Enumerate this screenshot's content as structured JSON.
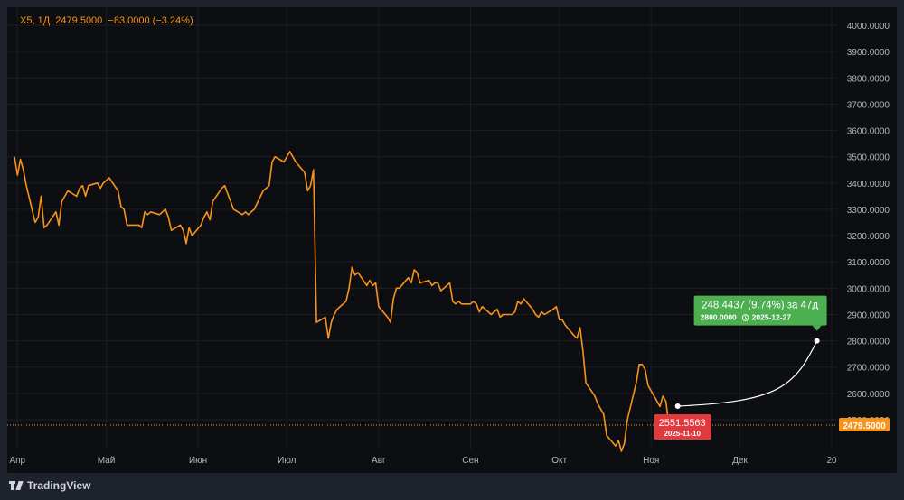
{
  "header": {
    "symbol": "X5",
    "interval": "1Д",
    "last_price": "2479.5000",
    "change": "−83.0000",
    "change_pct": "(−3.24%)"
  },
  "branding": {
    "name": "TradingView"
  },
  "colors": {
    "background": "#0d0e12",
    "line": "#f7931a",
    "grid": "#1b1d24",
    "axis_text": "#b2b5be",
    "price_label": "#f7931a",
    "measure_start": "#e03a3e",
    "measure_end": "#4caf50"
  },
  "measurement": {
    "start_price": "2551.5563",
    "start_date": "2025-11-10",
    "delta_text": "248.4437 (9.74%) за 47д",
    "end_price": "2800.0000",
    "end_date": "2025-12-27",
    "clock_icon": "clock-icon"
  },
  "chart_data": {
    "type": "line",
    "symbol": "X5",
    "interval": "1Д",
    "y_axis_ticks": [
      "4000.0000",
      "3900.0000",
      "3800.0000",
      "3700.0000",
      "3600.0000",
      "3500.0000",
      "3400.0000",
      "3300.0000",
      "3200.0000",
      "3100.0000",
      "3000.0000",
      "2900.0000",
      "2800.0000",
      "2700.0000",
      "2600.0000",
      "2500.0000"
    ],
    "x_axis_ticks": [
      "Апр",
      "Май",
      "Июн",
      "Июл",
      "Авг",
      "Сен",
      "Окт",
      "Ноя",
      "Дек",
      "20"
    ],
    "ylim": [
      2450,
      4040
    ],
    "xlim": [
      "2025-03-31",
      "2026-01-01"
    ],
    "last_price": 2479.5,
    "grid": true,
    "series": [
      {
        "values": [
          [
            "2025-03-31",
            3500
          ],
          [
            "2025-04-01",
            3430
          ],
          [
            "2025-04-02",
            3490
          ],
          [
            "2025-04-03",
            3450
          ],
          [
            "2025-04-04",
            3390
          ],
          [
            "2025-04-07",
            3250
          ],
          [
            "2025-04-08",
            3270
          ],
          [
            "2025-04-09",
            3350
          ],
          [
            "2025-04-10",
            3230
          ],
          [
            "2025-04-11",
            3240
          ],
          [
            "2025-04-14",
            3290
          ],
          [
            "2025-04-15",
            3240
          ],
          [
            "2025-04-16",
            3330
          ],
          [
            "2025-04-17",
            3350
          ],
          [
            "2025-04-18",
            3370
          ],
          [
            "2025-04-21",
            3350
          ],
          [
            "2025-04-22",
            3380
          ],
          [
            "2025-04-23",
            3390
          ],
          [
            "2025-04-24",
            3350
          ],
          [
            "2025-04-25",
            3390
          ],
          [
            "2025-04-28",
            3400
          ],
          [
            "2025-04-29",
            3380
          ],
          [
            "2025-04-30",
            3400
          ],
          [
            "2025-05-02",
            3420
          ],
          [
            "2025-05-05",
            3370
          ],
          [
            "2025-05-06",
            3310
          ],
          [
            "2025-05-07",
            3300
          ],
          [
            "2025-05-08",
            3240
          ],
          [
            "2025-05-12",
            3240
          ],
          [
            "2025-05-13",
            3230
          ],
          [
            "2025-05-14",
            3290
          ],
          [
            "2025-05-15",
            3280
          ],
          [
            "2025-05-16",
            3290
          ],
          [
            "2025-05-19",
            3280
          ],
          [
            "2025-05-20",
            3290
          ],
          [
            "2025-05-21",
            3300
          ],
          [
            "2025-05-22",
            3270
          ],
          [
            "2025-05-23",
            3220
          ],
          [
            "2025-05-26",
            3240
          ],
          [
            "2025-05-27",
            3220
          ],
          [
            "2025-05-28",
            3170
          ],
          [
            "2025-05-29",
            3230
          ],
          [
            "2025-05-30",
            3200
          ],
          [
            "2025-06-02",
            3240
          ],
          [
            "2025-06-03",
            3270
          ],
          [
            "2025-06-04",
            3290
          ],
          [
            "2025-06-05",
            3260
          ],
          [
            "2025-06-06",
            3330
          ],
          [
            "2025-06-09",
            3380
          ],
          [
            "2025-06-10",
            3390
          ],
          [
            "2025-06-11",
            3360
          ],
          [
            "2025-06-13",
            3300
          ],
          [
            "2025-06-16",
            3280
          ],
          [
            "2025-06-17",
            3290
          ],
          [
            "2025-06-18",
            3280
          ],
          [
            "2025-06-19",
            3290
          ],
          [
            "2025-06-20",
            3300
          ],
          [
            "2025-06-23",
            3370
          ],
          [
            "2025-06-24",
            3380
          ],
          [
            "2025-06-25",
            3390
          ],
          [
            "2025-06-26",
            3480
          ],
          [
            "2025-06-27",
            3500
          ],
          [
            "2025-06-30",
            3480
          ],
          [
            "2025-07-01",
            3500
          ],
          [
            "2025-07-02",
            3520
          ],
          [
            "2025-07-03",
            3500
          ],
          [
            "2025-07-04",
            3480
          ],
          [
            "2025-07-07",
            3440
          ],
          [
            "2025-07-08",
            3370
          ],
          [
            "2025-07-09",
            3390
          ],
          [
            "2025-07-10",
            3450
          ],
          [
            "2025-07-11",
            2870
          ],
          [
            "2025-07-14",
            2890
          ],
          [
            "2025-07-15",
            2810
          ],
          [
            "2025-07-16",
            2870
          ],
          [
            "2025-07-17",
            2900
          ],
          [
            "2025-07-18",
            2920
          ],
          [
            "2025-07-21",
            2950
          ],
          [
            "2025-07-22",
            3000
          ],
          [
            "2025-07-23",
            3080
          ],
          [
            "2025-07-24",
            3050
          ],
          [
            "2025-07-25",
            3060
          ],
          [
            "2025-07-28",
            3010
          ],
          [
            "2025-07-29",
            3030
          ],
          [
            "2025-07-30",
            3010
          ],
          [
            "2025-07-31",
            3020
          ],
          [
            "2025-08-01",
            2930
          ],
          [
            "2025-08-04",
            2890
          ],
          [
            "2025-08-05",
            2870
          ],
          [
            "2025-08-06",
            2960
          ],
          [
            "2025-08-07",
            3000
          ],
          [
            "2025-08-08",
            3000
          ],
          [
            "2025-08-11",
            3040
          ],
          [
            "2025-08-12",
            3020
          ],
          [
            "2025-08-13",
            3070
          ],
          [
            "2025-08-14",
            3060
          ],
          [
            "2025-08-15",
            3020
          ],
          [
            "2025-08-18",
            3030
          ],
          [
            "2025-08-19",
            3010
          ],
          [
            "2025-08-20",
            3020
          ],
          [
            "2025-08-21",
            3020
          ],
          [
            "2025-08-22",
            2990
          ],
          [
            "2025-08-25",
            3020
          ],
          [
            "2025-08-26",
            2950
          ],
          [
            "2025-08-27",
            2940
          ],
          [
            "2025-08-28",
            2950
          ],
          [
            "2025-08-29",
            2940
          ],
          [
            "2025-09-01",
            2940
          ],
          [
            "2025-09-02",
            2950
          ],
          [
            "2025-09-03",
            2940
          ],
          [
            "2025-09-04",
            2910
          ],
          [
            "2025-09-05",
            2930
          ],
          [
            "2025-09-08",
            2900
          ],
          [
            "2025-09-09",
            2910
          ],
          [
            "2025-09-10",
            2920
          ],
          [
            "2025-09-11",
            2890
          ],
          [
            "2025-09-12",
            2900
          ],
          [
            "2025-09-15",
            2900
          ],
          [
            "2025-09-16",
            2910
          ],
          [
            "2025-09-17",
            2950
          ],
          [
            "2025-09-18",
            2940
          ],
          [
            "2025-09-19",
            2960
          ],
          [
            "2025-09-22",
            2920
          ],
          [
            "2025-09-23",
            2900
          ],
          [
            "2025-09-24",
            2890
          ],
          [
            "2025-09-25",
            2910
          ],
          [
            "2025-09-26",
            2900
          ],
          [
            "2025-09-29",
            2920
          ],
          [
            "2025-09-30",
            2930
          ],
          [
            "2025-10-01",
            2880
          ],
          [
            "2025-10-02",
            2880
          ],
          [
            "2025-10-03",
            2860
          ],
          [
            "2025-10-06",
            2820
          ],
          [
            "2025-10-07",
            2810
          ],
          [
            "2025-10-08",
            2850
          ],
          [
            "2025-10-09",
            2760
          ],
          [
            "2025-10-10",
            2640
          ],
          [
            "2025-10-13",
            2590
          ],
          [
            "2025-10-14",
            2560
          ],
          [
            "2025-10-15",
            2540
          ],
          [
            "2025-10-16",
            2520
          ],
          [
            "2025-10-17",
            2440
          ],
          [
            "2025-10-20",
            2400
          ],
          [
            "2025-10-21",
            2420
          ],
          [
            "2025-10-22",
            2380
          ],
          [
            "2025-10-23",
            2410
          ],
          [
            "2025-10-24",
            2500
          ],
          [
            "2025-10-27",
            2640
          ],
          [
            "2025-10-28",
            2710
          ],
          [
            "2025-10-29",
            2710
          ],
          [
            "2025-10-30",
            2690
          ],
          [
            "2025-10-31",
            2630
          ],
          [
            "2025-11-03",
            2570
          ],
          [
            "2025-11-04",
            2550
          ],
          [
            "2025-11-05",
            2590
          ],
          [
            "2025-11-06",
            2570
          ],
          [
            "2025-11-07",
            2479.5
          ]
        ]
      }
    ]
  }
}
